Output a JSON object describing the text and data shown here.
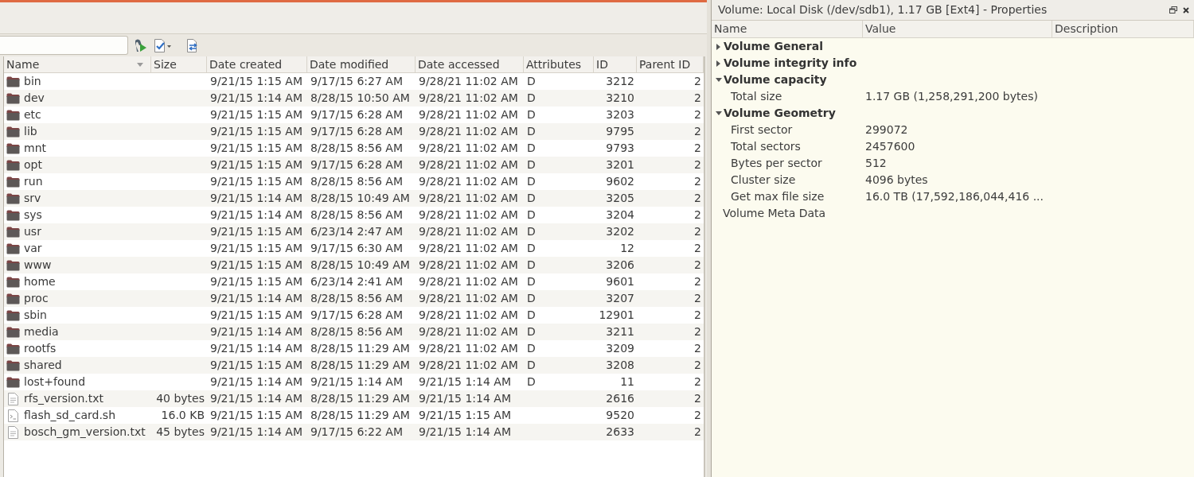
{
  "file_browser": {
    "columns": [
      {
        "label": "Name",
        "sorted": true
      },
      {
        "label": "Size",
        "sorted": false
      },
      {
        "label": "Date created",
        "sorted": false
      },
      {
        "label": "Date modified",
        "sorted": false
      },
      {
        "label": "Date accessed",
        "sorted": false
      },
      {
        "label": "Attributes",
        "sorted": false
      },
      {
        "label": "ID",
        "sorted": false
      },
      {
        "label": "Parent ID",
        "sorted": false
      }
    ],
    "rows": [
      {
        "kind": "folder",
        "name": "bin",
        "date_created": "9/21/15 1:15 AM",
        "date_modified": "9/17/15 6:27 AM",
        "date_accessed": "9/28/21 11:02 AM",
        "attributes": "D",
        "id": "3212",
        "parent_id": "2"
      },
      {
        "kind": "folder",
        "name": "dev",
        "date_created": "9/21/15 1:14 AM",
        "date_modified": "8/28/15 10:50 AM",
        "date_accessed": "9/28/21 11:02 AM",
        "attributes": "D",
        "id": "3210",
        "parent_id": "2"
      },
      {
        "kind": "folder",
        "name": "etc",
        "date_created": "9/21/15 1:15 AM",
        "date_modified": "9/17/15 6:28 AM",
        "date_accessed": "9/28/21 11:02 AM",
        "attributes": "D",
        "id": "3203",
        "parent_id": "2"
      },
      {
        "kind": "folder",
        "name": "lib",
        "date_created": "9/21/15 1:15 AM",
        "date_modified": "9/17/15 6:28 AM",
        "date_accessed": "9/28/21 11:02 AM",
        "attributes": "D",
        "id": "9795",
        "parent_id": "2"
      },
      {
        "kind": "folder",
        "name": "mnt",
        "date_created": "9/21/15 1:15 AM",
        "date_modified": "8/28/15 8:56 AM",
        "date_accessed": "9/28/21 11:02 AM",
        "attributes": "D",
        "id": "9793",
        "parent_id": "2"
      },
      {
        "kind": "folder",
        "name": "opt",
        "date_created": "9/21/15 1:15 AM",
        "date_modified": "9/17/15 6:28 AM",
        "date_accessed": "9/28/21 11:02 AM",
        "attributes": "D",
        "id": "3201",
        "parent_id": "2"
      },
      {
        "kind": "folder",
        "name": "run",
        "date_created": "9/21/15 1:15 AM",
        "date_modified": "8/28/15 8:56 AM",
        "date_accessed": "9/28/21 11:02 AM",
        "attributes": "D",
        "id": "9602",
        "parent_id": "2"
      },
      {
        "kind": "folder",
        "name": "srv",
        "date_created": "9/21/15 1:14 AM",
        "date_modified": "8/28/15 10:49 AM",
        "date_accessed": "9/28/21 11:02 AM",
        "attributes": "D",
        "id": "3205",
        "parent_id": "2"
      },
      {
        "kind": "folder",
        "name": "sys",
        "date_created": "9/21/15 1:14 AM",
        "date_modified": "8/28/15 8:56 AM",
        "date_accessed": "9/28/21 11:02 AM",
        "attributes": "D",
        "id": "3204",
        "parent_id": "2"
      },
      {
        "kind": "folder",
        "name": "usr",
        "date_created": "9/21/15 1:15 AM",
        "date_modified": "6/23/14 2:47 AM",
        "date_accessed": "9/28/21 11:02 AM",
        "attributes": "D",
        "id": "3202",
        "parent_id": "2"
      },
      {
        "kind": "folder",
        "name": "var",
        "date_created": "9/21/15 1:15 AM",
        "date_modified": "9/17/15 6:30 AM",
        "date_accessed": "9/28/21 11:02 AM",
        "attributes": "D",
        "id": "12",
        "parent_id": "2"
      },
      {
        "kind": "folder",
        "name": "www",
        "date_created": "9/21/15 1:15 AM",
        "date_modified": "8/28/15 10:49 AM",
        "date_accessed": "9/28/21 11:02 AM",
        "attributes": "D",
        "id": "3206",
        "parent_id": "2"
      },
      {
        "kind": "folder",
        "name": "home",
        "date_created": "9/21/15 1:15 AM",
        "date_modified": "6/23/14 2:41 AM",
        "date_accessed": "9/28/21 11:02 AM",
        "attributes": "D",
        "id": "9601",
        "parent_id": "2"
      },
      {
        "kind": "folder",
        "name": "proc",
        "date_created": "9/21/15 1:14 AM",
        "date_modified": "8/28/15 8:56 AM",
        "date_accessed": "9/28/21 11:02 AM",
        "attributes": "D",
        "id": "3207",
        "parent_id": "2"
      },
      {
        "kind": "folder",
        "name": "sbin",
        "date_created": "9/21/15 1:15 AM",
        "date_modified": "9/17/15 6:28 AM",
        "date_accessed": "9/28/21 11:02 AM",
        "attributes": "D",
        "id": "12901",
        "parent_id": "2"
      },
      {
        "kind": "folder",
        "name": "media",
        "date_created": "9/21/15 1:14 AM",
        "date_modified": "8/28/15 8:56 AM",
        "date_accessed": "9/28/21 11:02 AM",
        "attributes": "D",
        "id": "3211",
        "parent_id": "2"
      },
      {
        "kind": "folder",
        "name": "rootfs",
        "date_created": "9/21/15 1:14 AM",
        "date_modified": "8/28/15 11:29 AM",
        "date_accessed": "9/28/21 11:02 AM",
        "attributes": "D",
        "id": "3209",
        "parent_id": "2"
      },
      {
        "kind": "folder",
        "name": "shared",
        "date_created": "9/21/15 1:15 AM",
        "date_modified": "8/28/15 11:29 AM",
        "date_accessed": "9/28/21 11:02 AM",
        "attributes": "D",
        "id": "3208",
        "parent_id": "2"
      },
      {
        "kind": "folder",
        "name": "lost+found",
        "date_created": "9/21/15 1:14 AM",
        "date_modified": "9/21/15 1:14 AM",
        "date_accessed": "9/21/15 1:14 AM",
        "attributes": "D",
        "id": "11",
        "parent_id": "2"
      },
      {
        "kind": "text",
        "name": "rfs_version.txt",
        "size": "40 bytes",
        "date_created": "9/21/15 1:14 AM",
        "date_modified": "8/28/15 11:29 AM",
        "date_accessed": "9/21/15 1:14 AM",
        "id": "2616",
        "parent_id": "2"
      },
      {
        "kind": "script",
        "name": "flash_sd_card.sh",
        "size": "16.0 KB",
        "date_created": "9/21/15 1:15 AM",
        "date_modified": "8/28/15 11:29 AM",
        "date_accessed": "9/21/15 1:15 AM",
        "id": "9520",
        "parent_id": "2"
      },
      {
        "kind": "text",
        "name": "bosch_gm_version.txt",
        "size": "45 bytes",
        "date_created": "9/21/15 1:14 AM",
        "date_modified": "9/17/15 6:22 AM",
        "date_accessed": "9/21/15 1:14 AM",
        "id": "2633",
        "parent_id": "2"
      }
    ]
  },
  "properties_panel": {
    "title": "Volume: Local Disk (/dev/sdb1), 1.17 GB [Ext4] - Properties",
    "columns": [
      "Name",
      "Value",
      "Description"
    ],
    "rows": [
      {
        "kind": "group",
        "name": "Volume General",
        "expanded": false
      },
      {
        "kind": "group",
        "name": "Volume integrity info",
        "expanded": false
      },
      {
        "kind": "group",
        "name": "Volume capacity",
        "expanded": true,
        "children": [
          {
            "name": "Total size",
            "value": "1.17 GB (1,258,291,200 bytes)"
          }
        ]
      },
      {
        "kind": "group",
        "name": "Volume Geometry",
        "expanded": true,
        "children": [
          {
            "name": "First sector",
            "value": "299072"
          },
          {
            "name": "Total sectors",
            "value": "2457600"
          },
          {
            "name": "Bytes per sector",
            "value": "512"
          },
          {
            "name": "Cluster size",
            "value": "4096 bytes"
          },
          {
            "name": "Get max file size",
            "value": "16.0 TB (17,592,186,044,416 ..."
          }
        ]
      },
      {
        "kind": "item",
        "name": "Volume Meta Data"
      }
    ]
  }
}
